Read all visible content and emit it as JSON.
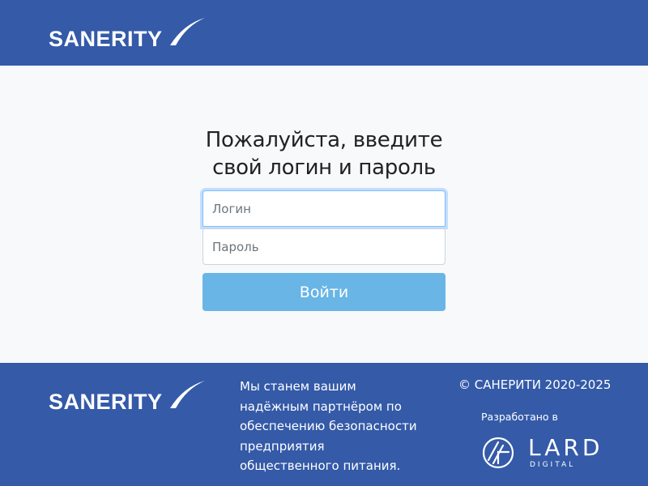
{
  "header": {
    "logo_text": "SANERITY"
  },
  "login_form": {
    "title_line1": "Пожалуйста, введите",
    "title_line2": "свой логин и пароль",
    "login_placeholder": "Логин",
    "password_placeholder": "Пароль",
    "submit_label": "Войти"
  },
  "footer": {
    "logo_text": "SANERITY",
    "tagline_lines": [
      "Мы станем вашим",
      "надёжным партнёром по",
      "обеспечению безопасности",
      "предприятия",
      "общественного питания."
    ],
    "copyright": "© САНЕРИТИ 2020-2025",
    "developed_by_label": "Разработано в",
    "developer_name": "LARD",
    "developer_subtitle": "DIGITAL"
  },
  "colors": {
    "brand_blue": "#345aa8",
    "button_blue": "#68b5e6",
    "page_background": "#f7f9fb",
    "focus_outline": "#80bdff"
  },
  "icons": {
    "brand_logo": "sanerity-swoosh-logo",
    "developer_logo": "lard-digital-logo"
  }
}
